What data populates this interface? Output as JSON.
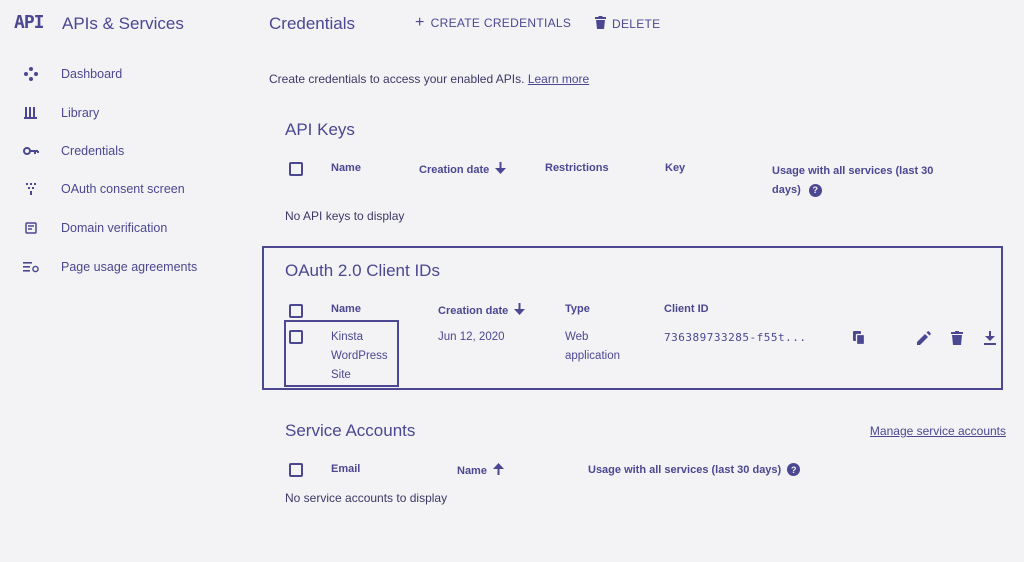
{
  "app": {
    "logo": "API",
    "product_title": "APIs & Services"
  },
  "sidebar": {
    "items": [
      {
        "label": "Dashboard",
        "icon": "dashboard-icon"
      },
      {
        "label": "Library",
        "icon": "library-icon"
      },
      {
        "label": "Credentials",
        "icon": "key-icon"
      },
      {
        "label": "OAuth consent screen",
        "icon": "consent-icon"
      },
      {
        "label": "Domain verification",
        "icon": "domain-icon"
      },
      {
        "label": "Page usage agreements",
        "icon": "settings-list-icon"
      }
    ]
  },
  "header": {
    "title": "Credentials",
    "create_label": "CREATE CREDENTIALS",
    "delete_label": "DELETE"
  },
  "intro": {
    "text": "Create credentials to access your enabled APIs.",
    "link": "Learn more"
  },
  "api_keys": {
    "title": "API Keys",
    "columns": {
      "name": "Name",
      "created": "Creation date",
      "restrictions": "Restrictions",
      "key": "Key",
      "usage_line1": "Usage with all services (last 30",
      "usage_line2": "days)"
    },
    "empty": "No API keys to display"
  },
  "oauth": {
    "title": "OAuth 2.0 Client IDs",
    "columns": {
      "name": "Name",
      "created": "Creation date",
      "type": "Type",
      "client_id": "Client ID"
    },
    "rows": [
      {
        "name_lines": [
          "Kinsta",
          "WordPress",
          "Site"
        ],
        "created": "Jun 12, 2020",
        "type_lines": [
          "Web",
          "application"
        ],
        "client_id": "736389733285-f55t..."
      }
    ]
  },
  "service_accounts": {
    "title": "Service Accounts",
    "manage_link": "Manage service accounts",
    "columns": {
      "email": "Email",
      "name": "Name",
      "usage": "Usage with all services (last 30 days)"
    },
    "empty": "No service accounts to display"
  },
  "colors": {
    "accent": "#4b4791",
    "background": "#f3f3f5"
  }
}
